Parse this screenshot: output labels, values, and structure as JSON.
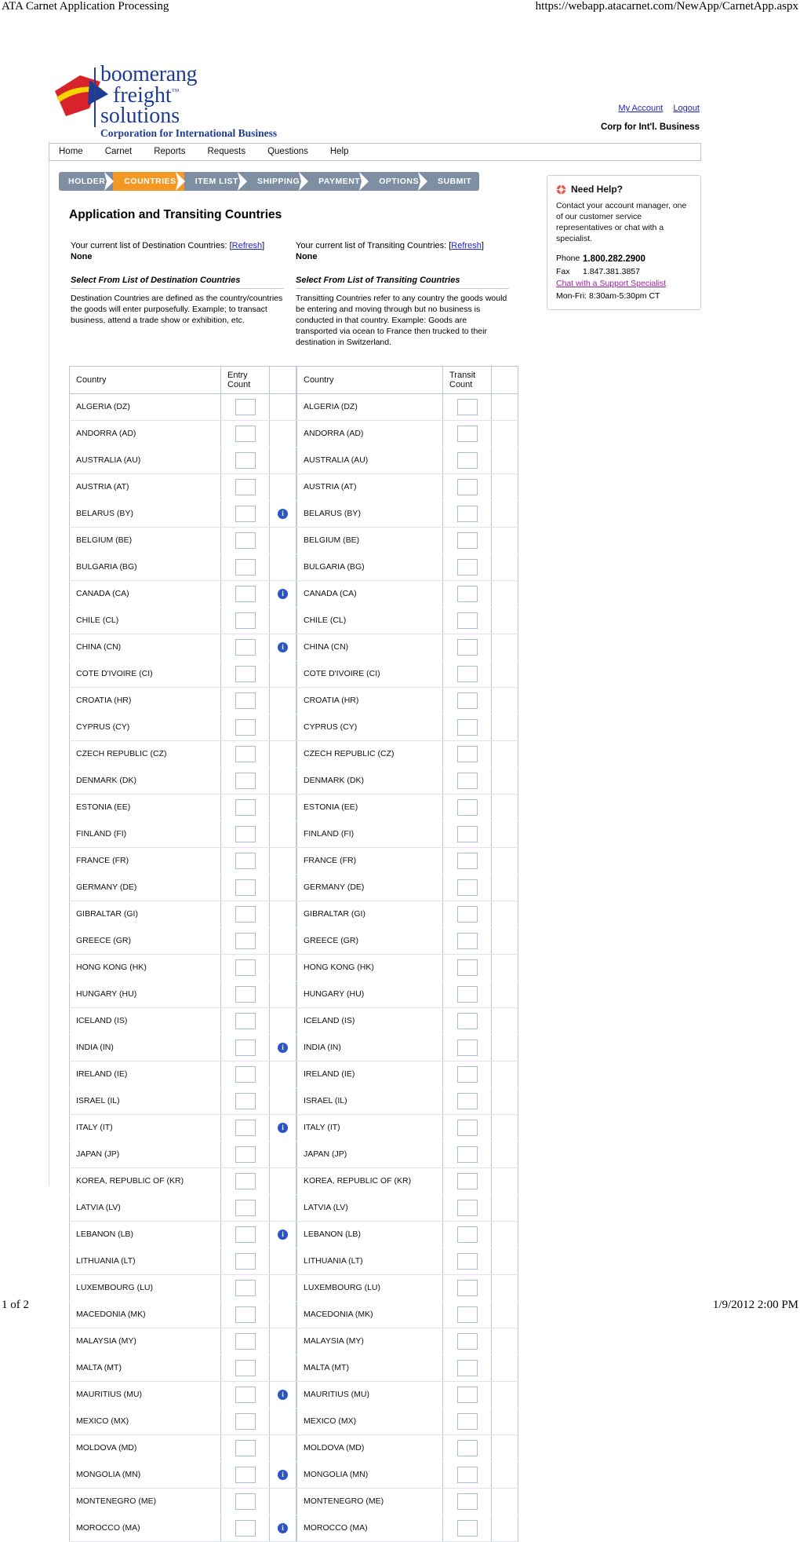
{
  "print": {
    "header_title": "ATA Carnet Application Processing",
    "header_url": "https://webapp.atacarnet.com/NewApp/CarnetApp.aspx",
    "footer_page": "1 of 2",
    "footer_timestamp": "1/9/2012 2:00 PM"
  },
  "branding": {
    "logo_line1": "boomerang",
    "logo_line2": "freight",
    "logo_tm": "™",
    "logo_line3": "solutions",
    "tagline": "Corporation for International Business",
    "logo_colors": {
      "red": "#d8232a",
      "yellow": "#f5d400",
      "blue": "#1f3c93",
      "text": "#1f3c93"
    }
  },
  "account": {
    "my_account": "My Account",
    "logout": "Logout",
    "company": "Corp for Int'l. Business"
  },
  "nav": {
    "items": [
      {
        "label": "Home"
      },
      {
        "label": "Carnet"
      },
      {
        "label": "Reports"
      },
      {
        "label": "Requests"
      },
      {
        "label": "Questions"
      },
      {
        "label": "Help"
      }
    ]
  },
  "steps": {
    "active_color": "#f49824",
    "inactive_color": "#7e8fa4",
    "items": [
      {
        "label": "HOLDER",
        "active": false
      },
      {
        "label": "COUNTRIES",
        "active": true
      },
      {
        "label": "ITEM LIST",
        "active": false
      },
      {
        "label": "SHIPPING",
        "active": false
      },
      {
        "label": "PAYMENT",
        "active": false
      },
      {
        "label": "OPTIONS",
        "active": false
      },
      {
        "label": "SUBMIT",
        "active": false
      }
    ]
  },
  "main": {
    "title": "Application and Transiting Countries",
    "destination": {
      "current_list_label": "Your current list of Destination Countries: [",
      "refresh_label": "Refresh",
      "current_list_suffix": "]",
      "current_value": "None",
      "select_heading": "Select From List of Destination Countries",
      "description": "Destination Countries are defined as the country/countries the goods will enter purposefully. Example; to transact business, attend a trade show or exhibition, etc."
    },
    "transiting": {
      "current_list_label": "Your current list of Transiting Countries: [",
      "refresh_label": "Refresh",
      "current_list_suffix": "]",
      "current_value": "None",
      "select_heading": "Select From List of Transiting Countries",
      "description": "Transitting Countries refer to any country the goods would be entering and moving through but no business is conducted in that country. Example: Goods are transported via ocean to France then trucked to their destination in Switzerland."
    }
  },
  "help": {
    "title": "Need Help?",
    "icon": "lifesaver-icon",
    "body": "Contact your account manager, one of our customer service representatives or chat with a specialist.",
    "phone_label": "Phone",
    "phone_value": "1.800.282.2900",
    "fax_label": "Fax",
    "fax_value": "1.847.381.3857",
    "chat_link": "Chat with a Support Specialist",
    "hours": "Mon-Fri: 8:30am-5:30pm CT",
    "chat_color": "#a0209c"
  },
  "table": {
    "dest_headers": {
      "country": "Country",
      "count": "Entry Count",
      "info": ""
    },
    "trans_headers": {
      "country": "Country",
      "count": "Transit Count",
      "info": ""
    },
    "rows": [
      {
        "country": "ALGERIA (DZ)",
        "entry_count": "",
        "transit_count": "",
        "info": false
      },
      {
        "country": "ANDORRA (AD)",
        "entry_count": "",
        "transit_count": "",
        "info": false
      },
      {
        "country": "AUSTRALIA (AU)",
        "entry_count": "",
        "transit_count": "",
        "info": false
      },
      {
        "country": "AUSTRIA (AT)",
        "entry_count": "",
        "transit_count": "",
        "info": false
      },
      {
        "country": "BELARUS (BY)",
        "entry_count": "",
        "transit_count": "",
        "info": true
      },
      {
        "country": "BELGIUM (BE)",
        "entry_count": "",
        "transit_count": "",
        "info": false
      },
      {
        "country": "BULGARIA (BG)",
        "entry_count": "",
        "transit_count": "",
        "info": false
      },
      {
        "country": "CANADA (CA)",
        "entry_count": "",
        "transit_count": "",
        "info": true
      },
      {
        "country": "CHILE (CL)",
        "entry_count": "",
        "transit_count": "",
        "info": false
      },
      {
        "country": "CHINA (CN)",
        "entry_count": "",
        "transit_count": "",
        "info": true
      },
      {
        "country": "COTE D'IVOIRE (CI)",
        "entry_count": "",
        "transit_count": "",
        "info": false
      },
      {
        "country": "CROATIA (HR)",
        "entry_count": "",
        "transit_count": "",
        "info": false
      },
      {
        "country": "CYPRUS (CY)",
        "entry_count": "",
        "transit_count": "",
        "info": false
      },
      {
        "country": "CZECH REPUBLIC (CZ)",
        "entry_count": "",
        "transit_count": "",
        "info": false
      },
      {
        "country": "DENMARK (DK)",
        "entry_count": "",
        "transit_count": "",
        "info": false
      },
      {
        "country": "ESTONIA (EE)",
        "entry_count": "",
        "transit_count": "",
        "info": false
      },
      {
        "country": "FINLAND (FI)",
        "entry_count": "",
        "transit_count": "",
        "info": false
      },
      {
        "country": "FRANCE (FR)",
        "entry_count": "",
        "transit_count": "",
        "info": false
      },
      {
        "country": "GERMANY (DE)",
        "entry_count": "",
        "transit_count": "",
        "info": false
      },
      {
        "country": "GIBRALTAR (GI)",
        "entry_count": "",
        "transit_count": "",
        "info": false
      },
      {
        "country": "GREECE (GR)",
        "entry_count": "",
        "transit_count": "",
        "info": false
      },
      {
        "country": "HONG KONG (HK)",
        "entry_count": "",
        "transit_count": "",
        "info": false
      },
      {
        "country": "HUNGARY (HU)",
        "entry_count": "",
        "transit_count": "",
        "info": false
      },
      {
        "country": "ICELAND (IS)",
        "entry_count": "",
        "transit_count": "",
        "info": false
      },
      {
        "country": "INDIA (IN)",
        "entry_count": "",
        "transit_count": "",
        "info": true
      },
      {
        "country": "IRELAND (IE)",
        "entry_count": "",
        "transit_count": "",
        "info": false
      },
      {
        "country": "ISRAEL (IL)",
        "entry_count": "",
        "transit_count": "",
        "info": false
      },
      {
        "country": "ITALY (IT)",
        "entry_count": "",
        "transit_count": "",
        "info": true
      },
      {
        "country": "JAPAN (JP)",
        "entry_count": "",
        "transit_count": "",
        "info": false
      },
      {
        "country": "KOREA, REPUBLIC OF (KR)",
        "entry_count": "",
        "transit_count": "",
        "info": false
      },
      {
        "country": "LATVIA (LV)",
        "entry_count": "",
        "transit_count": "",
        "info": false
      },
      {
        "country": "LEBANON (LB)",
        "entry_count": "",
        "transit_count": "",
        "info": true
      },
      {
        "country": "LITHUANIA (LT)",
        "entry_count": "",
        "transit_count": "",
        "info": false
      },
      {
        "country": "LUXEMBOURG (LU)",
        "entry_count": "",
        "transit_count": "",
        "info": false
      },
      {
        "country": "MACEDONIA (MK)",
        "entry_count": "",
        "transit_count": "",
        "info": false
      },
      {
        "country": "MALAYSIA (MY)",
        "entry_count": "",
        "transit_count": "",
        "info": false
      },
      {
        "country": "MALTA (MT)",
        "entry_count": "",
        "transit_count": "",
        "info": false
      },
      {
        "country": "MAURITIUS (MU)",
        "entry_count": "",
        "transit_count": "",
        "info": true
      },
      {
        "country": "MEXICO (MX)",
        "entry_count": "",
        "transit_count": "",
        "info": false
      },
      {
        "country": "MOLDOVA (MD)",
        "entry_count": "",
        "transit_count": "",
        "info": false
      },
      {
        "country": "MONGOLIA (MN)",
        "entry_count": "",
        "transit_count": "",
        "info": true
      },
      {
        "country": "MONTENEGRO (ME)",
        "entry_count": "",
        "transit_count": "",
        "info": false
      },
      {
        "country": "MOROCCO (MA)",
        "entry_count": "",
        "transit_count": "",
        "info": true
      }
    ]
  }
}
